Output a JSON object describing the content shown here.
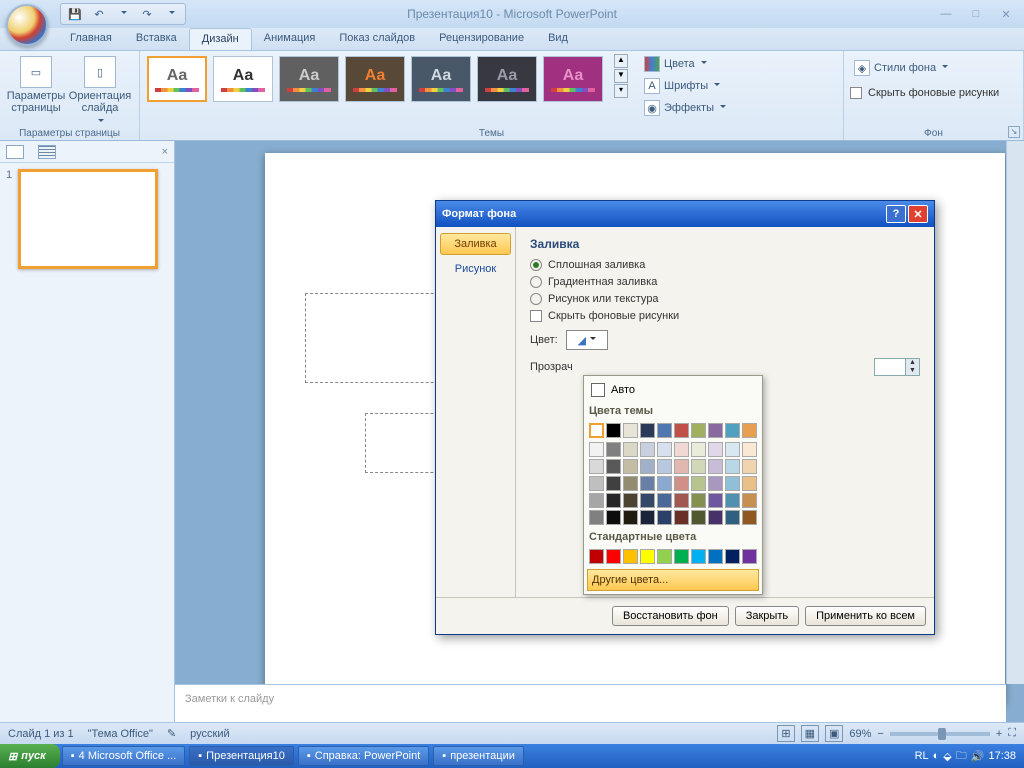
{
  "title": "Презентация10 - Microsoft PowerPoint",
  "qat": {
    "save": "💾",
    "undo": "↶",
    "redo": "↷"
  },
  "tabs": [
    "Главная",
    "Вставка",
    "Дизайн",
    "Анимация",
    "Показ слайдов",
    "Рецензирование",
    "Вид"
  ],
  "active_tab": 2,
  "ribbon": {
    "g1": {
      "label": "Параметры страницы",
      "btn1": "Параметры страницы",
      "btn2": "Ориентация слайда"
    },
    "g2": {
      "label": "Темы",
      "colors": "Цвета",
      "fonts": "Шрифты",
      "effects": "Эффекты"
    },
    "g3": {
      "label": "Фон",
      "styles": "Стили фона",
      "hide": "Скрыть фоновые рисунки"
    }
  },
  "themes": [
    {
      "bg": "#ffffff",
      "aa": "#666"
    },
    {
      "bg": "#ffffff",
      "aa": "#333"
    },
    {
      "bg": "#606060",
      "aa": "#ccc"
    },
    {
      "bg": "#584838",
      "aa": "#f08030"
    },
    {
      "bg": "#485868",
      "aa": "#d0d8e0"
    },
    {
      "bg": "#383840",
      "aa": "#9a9aa8"
    },
    {
      "bg": "#a03080",
      "aa": "#e890c8"
    }
  ],
  "slide_num": "1",
  "notes_placeholder": "Заметки к слайду",
  "status": {
    "slide": "Слайд 1 из 1",
    "theme": "\"Тема Office\"",
    "lang": "русский",
    "zoom": "69%"
  },
  "dialog": {
    "title": "Формат фона",
    "side": [
      "Заливка",
      "Рисунок"
    ],
    "heading": "Заливка",
    "radios": [
      "Сплошная заливка",
      "Градиентная заливка",
      "Рисунок или текстура"
    ],
    "hide_bg": "Скрыть фоновые рисунки",
    "color_label": "Цвет:",
    "opacity_label": "Прозрач",
    "btn_reset": "Восстановить фон",
    "btn_close": "Закрыть",
    "btn_all": "Применить ко всем"
  },
  "picker": {
    "auto": "Авто",
    "theme_head": "Цвета темы",
    "theme_row": [
      "#ffffff",
      "#000000",
      "#e8e4d8",
      "#2a3a58",
      "#5078b0",
      "#c05048",
      "#a0b060",
      "#886aa0",
      "#50a0c0",
      "#e8a050"
    ],
    "tints": [
      [
        "#f2f2f2",
        "#808080",
        "#dcd8c8",
        "#c8d0e0",
        "#d8e0f0",
        "#f0d8d4",
        "#e8ecd8",
        "#e0d8e8",
        "#d8e8f0",
        "#f8e8d4"
      ],
      [
        "#d9d9d9",
        "#595959",
        "#c4bca4",
        "#a0b0c8",
        "#b8c8e0",
        "#e0b8b0",
        "#d0d8b8",
        "#c8bcd8",
        "#b8d8e8",
        "#f0d4b0"
      ],
      [
        "#bfbfbf",
        "#404040",
        "#948c70",
        "#6880a8",
        "#8aa8d0",
        "#d09088",
        "#b8c490",
        "#a898c0",
        "#90c0d8",
        "#e8c088"
      ],
      [
        "#a6a6a6",
        "#262626",
        "#4a4430",
        "#344868",
        "#4a6898",
        "#a05850",
        "#849050",
        "#7058a0",
        "#5090b0",
        "#c89050"
      ],
      [
        "#808080",
        "#0d0d0d",
        "#201c10",
        "#1a2438",
        "#2a4068",
        "#683028",
        "#505830",
        "#483068",
        "#306080",
        "#905820"
      ]
    ],
    "std_head": "Стандартные цвета",
    "std": [
      "#c00000",
      "#ff0000",
      "#ffc000",
      "#ffff00",
      "#92d050",
      "#00b050",
      "#00b0f0",
      "#0070c0",
      "#002060",
      "#7030a0"
    ],
    "more": "Другие цвета..."
  },
  "taskbar": {
    "start": "пуск",
    "items": [
      "4 Microsoft Office ...",
      "Презентация10",
      "Справка: PowerPoint",
      "презентации"
    ],
    "tray": "RL",
    "time": "17:38"
  }
}
